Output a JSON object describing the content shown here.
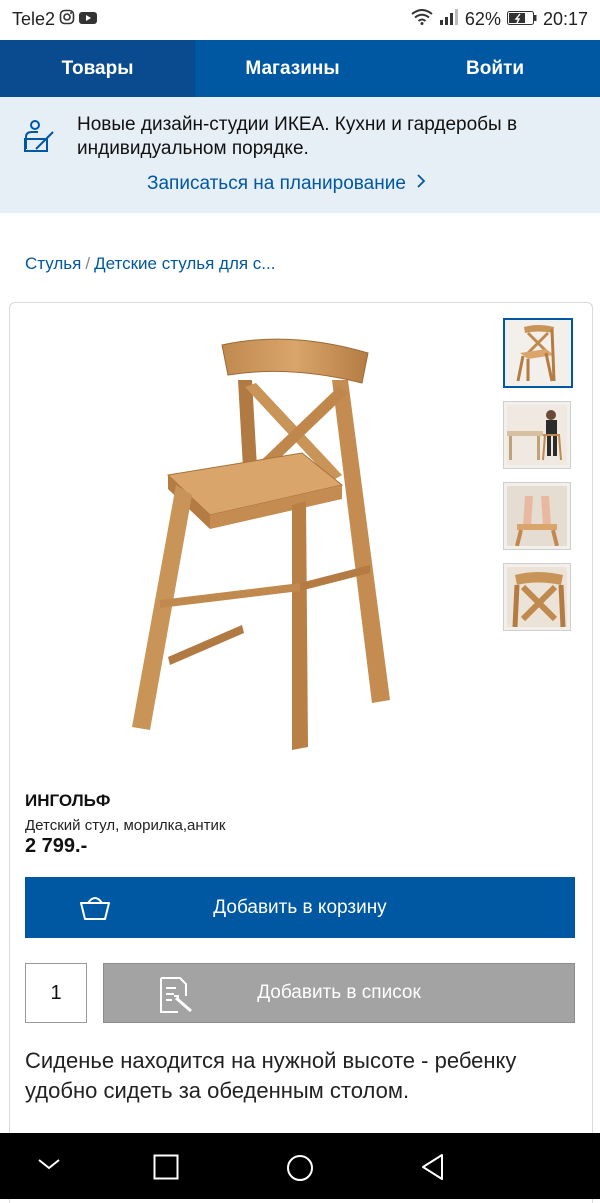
{
  "status_bar": {
    "carrier": "Tele2",
    "battery": "62%",
    "time": "20:17",
    "icons": [
      "instagram-icon",
      "youtube-icon",
      "wifi-icon",
      "signal-icon",
      "battery-icon"
    ]
  },
  "nav": {
    "tabs": [
      {
        "label": "Товары",
        "active": true
      },
      {
        "label": "Магазины",
        "active": false
      },
      {
        "label": "Войти",
        "active": false
      }
    ]
  },
  "promo": {
    "text": "Новые дизайн-студии ИКЕА. Кухни и гардеробы в индивидуальном порядке.",
    "link": "Записаться на планирование"
  },
  "breadcrumb": {
    "items": [
      "Стулья",
      "Детские стулья для с..."
    ],
    "separator": "/"
  },
  "product": {
    "name": "ИНГОЛЬФ",
    "description": "Детский стул, морилка,антик",
    "price": "2 799.-",
    "add_to_cart": "Добавить в корзину",
    "quantity": "1",
    "add_to_list": "Добавить в список",
    "summary": "Сиденье находится на нужной высоте - ребенку удобно сидеть за обеденным столом.",
    "thumbnails": [
      "chair-front",
      "chair-table-scene",
      "child-on-chair",
      "chair-closeup"
    ],
    "selected_thumbnail": 1
  },
  "colors": {
    "brand_blue": "#0058a3",
    "promo_bg": "#e6eef6",
    "list_button_gray": "#a3a3a3"
  }
}
